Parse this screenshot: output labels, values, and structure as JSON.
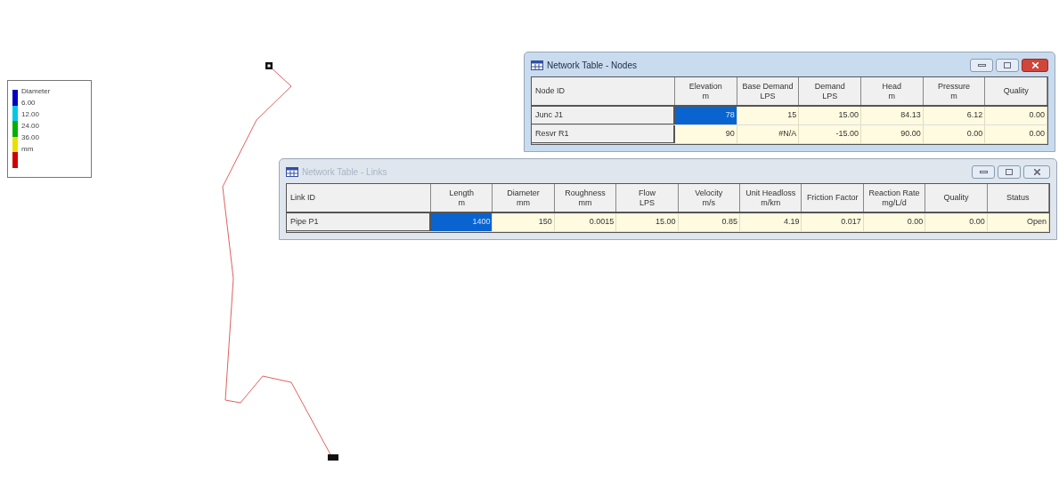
{
  "legend": {
    "title": "Diameter",
    "unit": "mm",
    "levels": [
      {
        "label": "6.00",
        "color": "#0000c0"
      },
      {
        "label": "12.00",
        "color": "#00c8e8"
      },
      {
        "label": "24.00",
        "color": "#00b000"
      },
      {
        "label": "36.00",
        "color": "#e8e000"
      },
      {
        "color": "#d00000"
      }
    ]
  },
  "windows": [
    {
      "title": "Network Table - Nodes",
      "active": true,
      "columns": [
        {
          "name": "Node ID"
        },
        {
          "name": "Elevation",
          "unit": "m"
        },
        {
          "name": "Base Demand",
          "unit": "LPS"
        },
        {
          "name": "Demand",
          "unit": "LPS"
        },
        {
          "name": "Head",
          "unit": "m"
        },
        {
          "name": "Pressure",
          "unit": "m"
        },
        {
          "name": "Quality"
        }
      ],
      "rows": [
        {
          "cells": [
            {
              "text": "Junc J1",
              "selected": false
            },
            {
              "text": "78",
              "selected": true
            },
            {
              "text": "15",
              "selected": false
            },
            {
              "text": "15.00",
              "selected": false
            },
            {
              "text": "84.13",
              "selected": false
            },
            {
              "text": "6.12",
              "selected": false
            },
            {
              "text": "0.00",
              "selected": false
            }
          ]
        },
        {
          "cells": [
            {
              "text": "Resvr R1",
              "selected": false
            },
            {
              "text": "90",
              "selected": false
            },
            {
              "text": "#N/A",
              "selected": false
            },
            {
              "text": "-15.00",
              "selected": false
            },
            {
              "text": "90.00",
              "selected": false
            },
            {
              "text": "0.00",
              "selected": false
            },
            {
              "text": "0.00",
              "selected": false
            }
          ]
        }
      ]
    },
    {
      "title": "Network Table - Links",
      "active": false,
      "columns": [
        {
          "name": "Link ID"
        },
        {
          "name": "Length",
          "unit": "m"
        },
        {
          "name": "Diameter",
          "unit": "mm"
        },
        {
          "name": "Roughness",
          "unit": "mm"
        },
        {
          "name": "Flow",
          "unit": "LPS"
        },
        {
          "name": "Velocity",
          "unit": "m/s"
        },
        {
          "name": "Unit Headloss",
          "unit": "m/km"
        },
        {
          "name": "Friction Factor"
        },
        {
          "name": "Reaction Rate",
          "unit": "mg/L/d"
        },
        {
          "name": "Quality"
        },
        {
          "name": "Status"
        }
      ],
      "rows": [
        {
          "cells": [
            {
              "text": "Pipe P1",
              "selected": false
            },
            {
              "text": "1400",
              "selected": true
            },
            {
              "text": "150",
              "selected": false
            },
            {
              "text": "0.0015",
              "selected": false
            },
            {
              "text": "15.00",
              "selected": false
            },
            {
              "text": "0.85",
              "selected": false
            },
            {
              "text": "4.19",
              "selected": false
            },
            {
              "text": "0.017",
              "selected": false
            },
            {
              "text": "0.00",
              "selected": false
            },
            {
              "text": "0.00",
              "selected": false
            },
            {
              "text": "Open",
              "selected": false
            }
          ]
        }
      ]
    }
  ]
}
